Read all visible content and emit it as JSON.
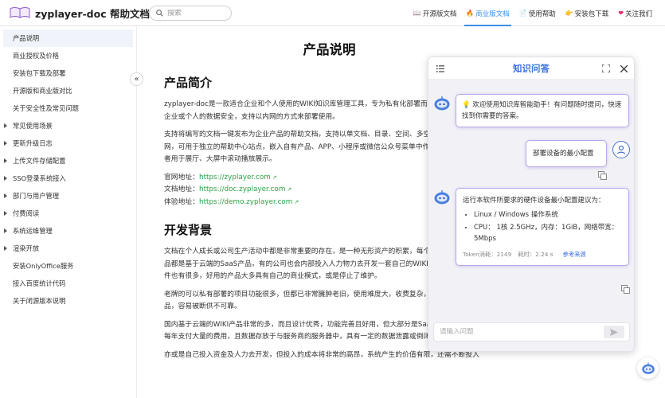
{
  "header": {
    "brand": "zyplayer-doc 帮助文档",
    "search_placeholder": "搜索",
    "nav": [
      {
        "icon": "📖",
        "label": "开源版文档",
        "active": false
      },
      {
        "icon": "🔥",
        "label": "商业版文档",
        "active": true
      },
      {
        "icon": "📄",
        "label": "使用帮助",
        "active": false
      },
      {
        "icon": "👉",
        "label": "安装包下载",
        "active": false
      },
      {
        "icon": "❤",
        "label": "关注我们",
        "active": false
      }
    ]
  },
  "sidebar": {
    "items": [
      {
        "label": "产品说明",
        "caret": false,
        "active": true
      },
      {
        "label": "商业授权及价格",
        "caret": false,
        "active": false
      },
      {
        "label": "安装包下载及部署",
        "caret": false,
        "active": false
      },
      {
        "label": "开源版和商业版对比",
        "caret": false,
        "active": false
      },
      {
        "label": "关于安全性及常见问题",
        "caret": false,
        "active": false
      },
      {
        "label": "常见使用场景",
        "caret": true,
        "active": false
      },
      {
        "label": "更新升级日志",
        "caret": true,
        "active": false
      },
      {
        "label": "上传文件存储配置",
        "caret": true,
        "active": false
      },
      {
        "label": "SSO登录系统接入",
        "caret": true,
        "active": false
      },
      {
        "label": "部门与用户管理",
        "caret": true,
        "active": false
      },
      {
        "label": "付费阅读",
        "caret": true,
        "active": false
      },
      {
        "label": "系统运维管理",
        "caret": true,
        "active": false
      },
      {
        "label": "渲染开放",
        "caret": true,
        "active": false
      },
      {
        "label": "安装OnlyOffice服务",
        "caret": false,
        "active": false
      },
      {
        "label": "接入百度统计代码",
        "caret": false,
        "active": false
      },
      {
        "label": "关于闭源版本说明",
        "caret": false,
        "active": false
      }
    ],
    "collapse_glyph": "«"
  },
  "content": {
    "title": "产品说明",
    "section1_heading": "产品简介",
    "p1": "zyplayer-doc是一款适合企业和个人使用的WIKI知识库管理工具，专为私有化部署而设计，最大程度上保证企业或个人的数据安全，支持以内网的方式来部署使用。",
    "p2": "支持将编写的文档一键发布为企业产品的帮助文档，支持以单文档、目录、空间、多空间的方式发布到互联网，可用于独立的帮助中心站点，嵌入自有产品、APP、小程序或微信公众号菜单中作为帮助文档使用，或者用于展厅、大屏中滚动播放展示。",
    "links": [
      {
        "label": "官网地址：",
        "url": "https://zyplayer.com"
      },
      {
        "label": "文档地址：",
        "url": "https://doc.zyplayer.com"
      },
      {
        "label": "体验地址：",
        "url": "https://demo.zyplayer.com"
      }
    ],
    "section2_heading": "开发背景",
    "p3": "文档在个人成长或公司生产活动中都是非常重要的存在，是一种无形资产的积累，每个公司都有一个WIKI产品都是基于云端的SaaS产品，有的公司也会内部投入人力物力去开发一套自己的WIKI文档管理系统。开源软件也有很多，好用的产品大多具有自己的商业模式，或是停止了维护。",
    "p4": "老牌的可以私有部署的项目功能很多，但都已非常臃肿老旧，使用难度大，收费复杂，又基本都是国外产品，容易被断供不可靠。",
    "p5": "国内基于云端的WIKI产品非常的多，而且设计优秀，功能完善且好用，但大部分是SaaS服务，需要使用人数每年支付大量的费用，且数据存放于与服务商的服务器中，具有一定的数据泄露或倒闭断供的风险。",
    "p6": "亦或是自己投入资金及人力去开发，但投入的成本将非常的高昂，系统产生的价值有限，还需不断投入"
  },
  "chat": {
    "title": "知识问答",
    "welcome": "💡 欢迎使用知识库智能助手！有问题随时提问，快速找到你需要的答案。",
    "user_question": "部署设备的最小配置",
    "answer_intro": "运行本软件所要求的硬件设备最小配置建议为：",
    "answer_items": [
      "Linux / Windows 操作系统",
      "CPU： 1核 2.5GHz，内存：1GiB，网络带宽：5Mbps"
    ],
    "token_text": "Token消耗：2149",
    "time_text": "耗时：2.24 s",
    "source_link": "参考来源",
    "input_placeholder": "请输入问题"
  },
  "colors": {
    "accent": "#3a8ee6",
    "link_green": "#2ba245",
    "chat_title": "#3b6fe0",
    "bubble_border": "#b9a6ea"
  }
}
